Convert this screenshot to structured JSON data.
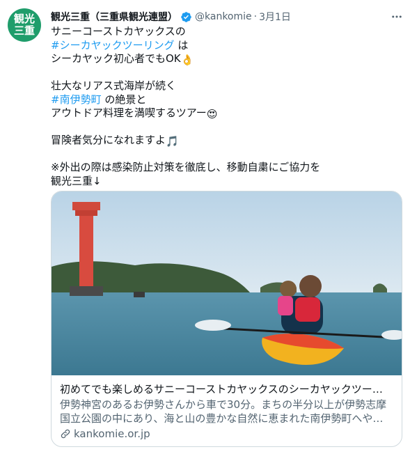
{
  "author": {
    "avatar_text_top": "観光",
    "avatar_text_bottom": "三重",
    "name": "観光三重（三重県観光連盟）",
    "handle": "@kankomie",
    "separator": "·",
    "date": "3月1日"
  },
  "tweet": {
    "line1": "サニーコーストカヤックスの",
    "hashtag1": "#シーカヤックツーリング",
    "line2_suffix": " は",
    "line3": "シーカヤック初心者でもOK",
    "emoji_ok": "👌",
    "line4": "壮大なリアス式海岸が続く",
    "hashtag2": "#南伊勢町",
    "line5_suffix": " の絶景と",
    "line6": "アウトドア料理を満喫するツアー",
    "emoji_heart_eyes": "😍",
    "line7": "冒険者気分になれますよ",
    "emoji_music": "🎵",
    "line8": "※外出の際は感染防止対策を徹底し、移動自粛にご協力を",
    "line9": "観光三重↓"
  },
  "card": {
    "title": "初めてでも楽しめるサニーコーストカヤックスのシーカヤックツーリ…",
    "desc_line1": "伊勢神宮のあるお伊勢さんから車で30分。まちの半分以上が伊勢志摩",
    "desc_line2": "国立公園の中にあり、海と山の豊かな自然に恵まれた南伊勢町へやっ…",
    "domain": "kankomie.or.jp"
  },
  "icons": {
    "verified": "verified-badge-icon",
    "more": "more-options-icon",
    "link": "link-icon"
  },
  "colors": {
    "accent": "#1d9bf0",
    "avatar_bg": "#1f9d6b",
    "secondary_text": "#536471",
    "border": "#cfd9de"
  }
}
